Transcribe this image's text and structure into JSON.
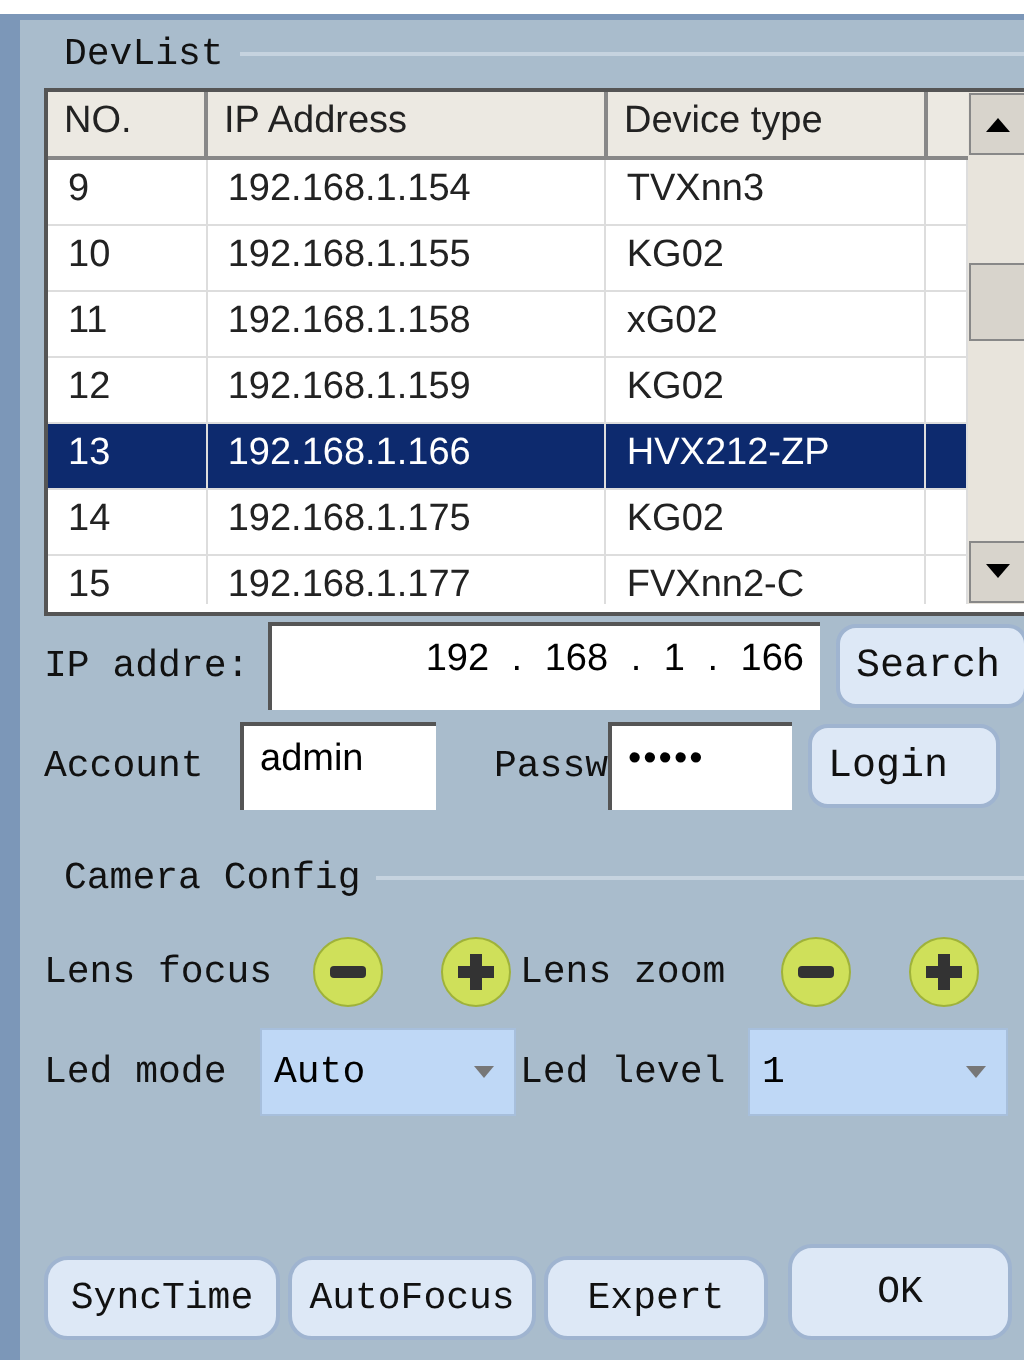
{
  "devlist": {
    "title": "DevList",
    "columns": [
      "NO.",
      "IP Address",
      "Device type"
    ],
    "rows": [
      {
        "cells": [
          "9",
          "192.168.1.154",
          "TVXnn3"
        ],
        "selected": false
      },
      {
        "cells": [
          "10",
          "192.168.1.155",
          "KG02"
        ],
        "selected": false
      },
      {
        "cells": [
          "11",
          "192.168.1.158",
          "xG02"
        ],
        "selected": false
      },
      {
        "cells": [
          "12",
          "192.168.1.159",
          "KG02"
        ],
        "selected": false
      },
      {
        "cells": [
          "13",
          "192.168.1.166",
          "HVX212-ZP"
        ],
        "selected": true
      },
      {
        "cells": [
          "14",
          "192.168.1.175",
          "KG02"
        ],
        "selected": false
      },
      {
        "cells": [
          "15",
          "192.168.1.177",
          "FVXnn2-C"
        ],
        "selected": false
      }
    ]
  },
  "connection": {
    "ip_label": "IP addre:",
    "ip_address": "192 . 168 . 1 . 166",
    "account_label": "Account",
    "account": "admin",
    "password_label": "Passw",
    "password": "•••••",
    "buttons": [
      "Search",
      "Login"
    ]
  },
  "camera_config": {
    "title": "Camera Config",
    "lens": [
      {
        "label": "Lens focus"
      },
      {
        "label": "Lens zoom"
      }
    ],
    "selects": [
      {
        "label": "Led mode",
        "value": "Auto"
      },
      {
        "label": "Led level",
        "value": "1"
      }
    ]
  },
  "buttons": [
    "SyncTime",
    "AutoFocus",
    "Expert",
    "OK"
  ]
}
